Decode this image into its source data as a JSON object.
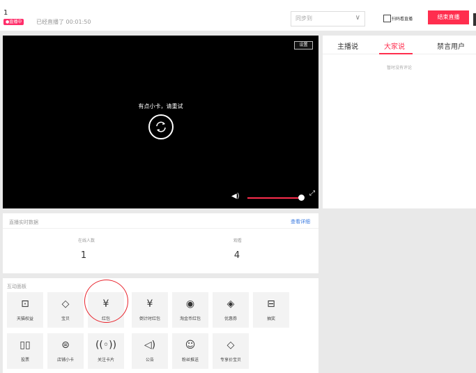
{
  "header": {
    "title": "1",
    "live_badge": "●直播中",
    "live_status": "已经直播了 00:01:50",
    "sync_select": {
      "value": "同步到",
      "chevron": "chevron-down-icon"
    },
    "qr_label": "扫码看直播",
    "end_button": "结束直播"
  },
  "video": {
    "settings_label": "设置",
    "error_message": "有点小卡，请重试",
    "volume_level": 0.93
  },
  "side_tabs": {
    "items": [
      {
        "label": "主播说"
      },
      {
        "label": "大家说"
      },
      {
        "label": "禁言用户"
      }
    ],
    "active_index": 1,
    "empty_text": "暂时没有评论"
  },
  "stats": {
    "title": "直播实时数据",
    "detail_link": "查看详细",
    "items": [
      {
        "label": "在线人数",
        "value": "1"
      },
      {
        "label": "观看",
        "value": "4"
      }
    ]
  },
  "panel": {
    "title": "互动面板",
    "tools": [
      {
        "label": "天猫权益",
        "icon": "tmall-icon",
        "glyph": "⊡"
      },
      {
        "label": "宝贝",
        "icon": "tag-icon",
        "glyph": "◇"
      },
      {
        "label": "红包",
        "icon": "red-packet-icon",
        "glyph": "¥"
      },
      {
        "label": "倒计时红包",
        "icon": "timer-red-packet-icon",
        "glyph": "¥"
      },
      {
        "label": "淘金币红包",
        "icon": "coin-icon",
        "glyph": "◉"
      },
      {
        "label": "优惠券",
        "icon": "coupon-icon",
        "glyph": "◈"
      },
      {
        "label": "抽奖",
        "icon": "gift-box-icon",
        "glyph": "⊟"
      },
      {
        "label": "投票",
        "icon": "vote-icon",
        "glyph": "▯▯"
      },
      {
        "label": "店铺小卡",
        "icon": "shop-icon",
        "glyph": "⊜"
      },
      {
        "label": "关注卡片",
        "icon": "follow-icon",
        "glyph": "((◦))"
      },
      {
        "label": "公告",
        "icon": "speaker-icon",
        "glyph": "◁)"
      },
      {
        "label": "粉丝推送",
        "icon": "chat-icon",
        "glyph": "☺"
      },
      {
        "label": "专享价宝贝",
        "icon": "exclusive-price-icon",
        "glyph": "◇"
      }
    ]
  },
  "colors": {
    "accent": "#ff2e4e",
    "link": "#3a7ae0",
    "highlight": "#e8222b"
  }
}
